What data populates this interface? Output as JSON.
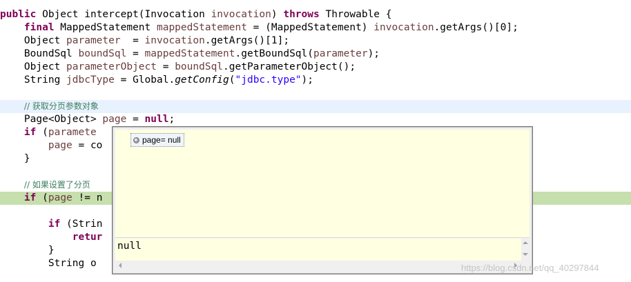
{
  "code": {
    "l1": {
      "kw": "public",
      "t1": " Object intercept(Invocation ",
      "v1": "invocation",
      "t2": ") ",
      "kw2": "throws",
      "t3": " Throwable {"
    },
    "l2": {
      "indent": "    ",
      "kw": "final",
      "t1": " MappedStatement ",
      "v1": "mappedStatement",
      "t2": " = (MappedStatement) ",
      "v2": "invocation",
      "t3": ".getArgs()[0];"
    },
    "l3": {
      "indent": "    ",
      "t1": "Object ",
      "v1": "parameter",
      "t2": "  = ",
      "v2": "invocation",
      "t3": ".getArgs()[1];"
    },
    "l4": {
      "indent": "    ",
      "t1": "BoundSql ",
      "v1": "boundSql",
      "t2": " = ",
      "v2": "mappedStatement",
      "t3": ".getBoundSql(",
      "v3": "parameter",
      "t4": ");"
    },
    "l5": {
      "indent": "    ",
      "t1": "Object ",
      "v1": "parameterObject",
      "t2": " = ",
      "v2": "boundSql",
      "t3": ".getParameterObject();"
    },
    "l6": {
      "indent": "    ",
      "t1": "String ",
      "v1": "jdbcType",
      "t2": " = Global.",
      "m1": "getConfig",
      "t3": "(",
      "s1": "\"jdbc.type\"",
      "t4": ");"
    },
    "l8": {
      "indent": "    ",
      "cmt": "// 获取分页参数对象"
    },
    "l9": {
      "indent": "    ",
      "t1": "Page<Object> ",
      "v1": "page",
      "t2": " = ",
      "kw": "null",
      "t3": ";"
    },
    "l10": {
      "indent": "    ",
      "kw": "if",
      "t1": " (",
      "v1": "paramete"
    },
    "l11": {
      "indent": "        ",
      "v1": "page",
      "t1": " = co"
    },
    "l12": {
      "indent": "    ",
      "t1": "}"
    },
    "l14": {
      "indent": "    ",
      "cmt": "// 如果设置了分页"
    },
    "l15": {
      "indent": "    ",
      "kw": "if",
      "t1": " (",
      "v1": "page",
      "t2": " != n"
    },
    "l17": {
      "indent": "        ",
      "kw": "if",
      "t1": " (Strin"
    },
    "l18": {
      "indent": "            ",
      "kw": "retur"
    },
    "l19": {
      "indent": "        ",
      "t1": "}"
    },
    "l20": {
      "indent": "        ",
      "t1": "String o"
    }
  },
  "popup": {
    "tree_item": "page= null",
    "detail_value": "null"
  },
  "watermark": "https://blog.csdn.net/qq_40297844"
}
